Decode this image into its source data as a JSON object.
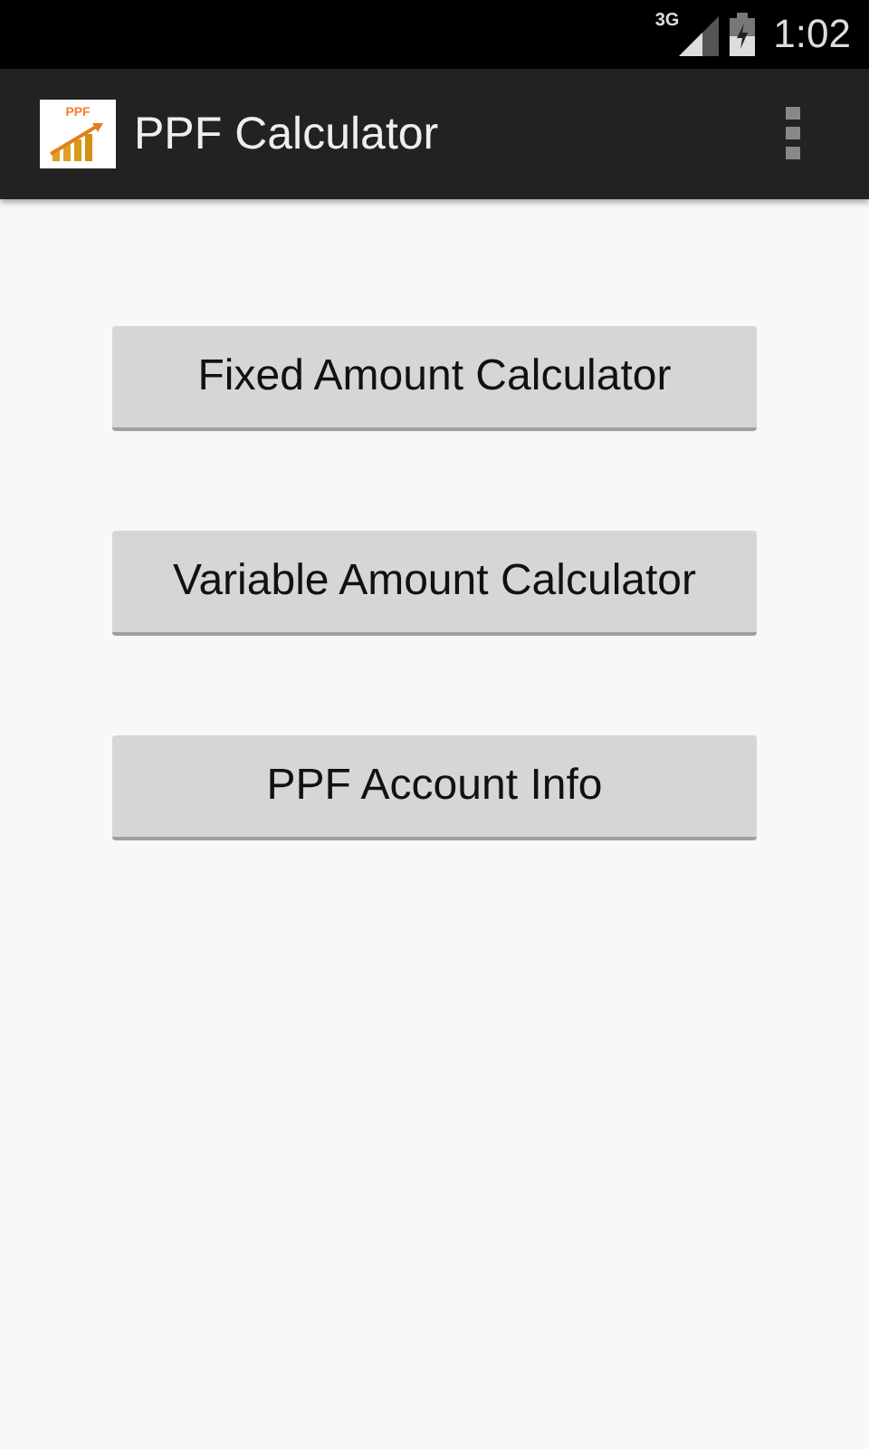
{
  "status_bar": {
    "network": "3G",
    "time": "1:02"
  },
  "action_bar": {
    "logo_text": "PPF",
    "title": "PPF Calculator"
  },
  "buttons": [
    "Fixed Amount Calculator",
    "Variable Amount Calculator",
    "PPF Account Info"
  ]
}
